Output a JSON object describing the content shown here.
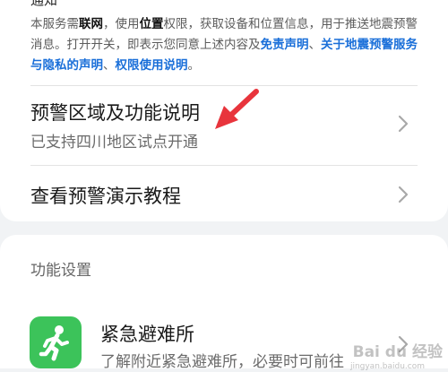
{
  "header": {
    "cut_title": "通知"
  },
  "notice": {
    "t1": "本服务需",
    "b1": "联网",
    "t2": "，使用",
    "b2": "位置",
    "t3": "权限，获取设备和位置信息，用于推送地震预警消息。打开开关，即表示您同意上述内容及",
    "l1": "免责声明",
    "t4": "、",
    "l2": "关于地震预警服务与隐私的声明",
    "t5": "、",
    "l3": "权限使用说明",
    "t6": "。"
  },
  "rows": {
    "region_title": "预警区域及功能说明",
    "region_sub": "已支持四川地区试点开通",
    "tutorial_title": "查看预警演示教程"
  },
  "settings": {
    "header": "功能设置",
    "shelter_title": "紧急避难所",
    "shelter_sub": "了解附近紧急避难所，必要时可前往"
  },
  "watermark": {
    "text": "Bai du 经验",
    "sub": "jingyan.baidu.com"
  },
  "colors": {
    "accent_link": "#1a6fd9",
    "annotation_arrow": "#e8343c",
    "shelter_icon_bg": "#3cc35a"
  },
  "icons": [
    "chevron-right-icon",
    "running-person-icon",
    "red-arrow-annotation"
  ]
}
